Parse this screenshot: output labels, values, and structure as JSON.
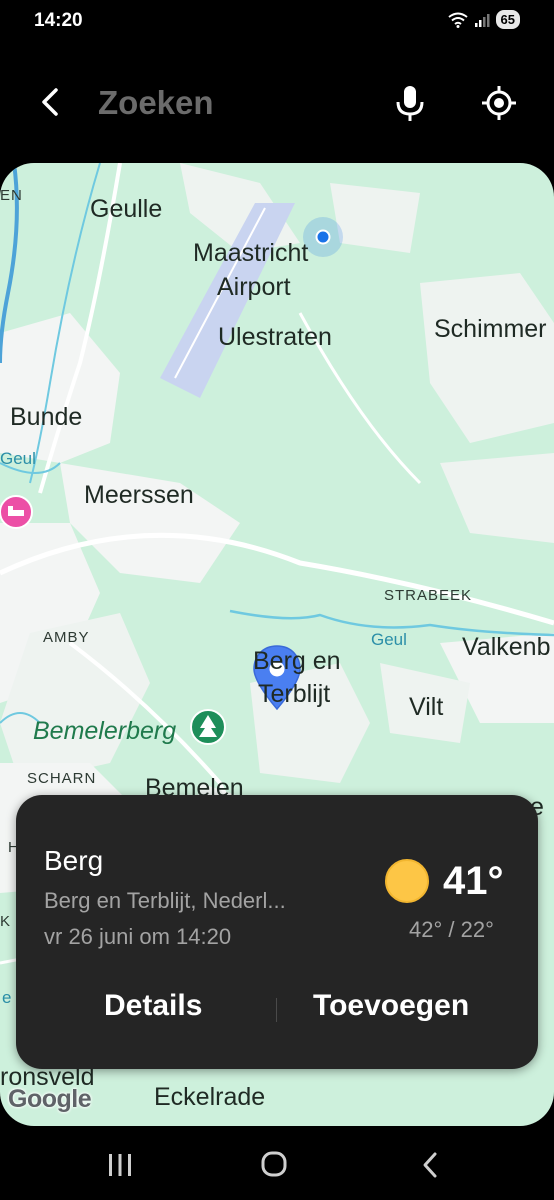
{
  "status_bar": {
    "time": "14:20",
    "battery": "65",
    "icons": [
      "wifi-icon",
      "signal-icon",
      "battery-icon"
    ]
  },
  "search": {
    "placeholder": "Zoeken",
    "value": "",
    "icons": [
      "back-arrow-icon",
      "mic-icon",
      "my-location-icon"
    ]
  },
  "map": {
    "labels": {
      "geulle": "Geulle",
      "en": "EN",
      "maastricht_airport_1": "Maastricht",
      "maastricht_airport_2": "Airport",
      "ulestraten": "Ulestraten",
      "schimmert": "Schimmer",
      "bunde": "Bunde",
      "geul_west": "Geul",
      "meerssen": "Meerssen",
      "strabeek": "STRABEEK",
      "amby": "AMBY",
      "geul_east": "Geul",
      "valkenburg": "Valkenb",
      "berg_1": "Berg en",
      "berg_2": "Terblijt",
      "vilt": "Vilt",
      "bemelerberg": "Bemelerberg",
      "scharn": "SCHARN",
      "bemelen": "Bemelen",
      "cadier_fragment": "e",
      "ronsveld": "ronsveld",
      "eckelrade": "Eckelrade",
      "left_edge_h": "H",
      "left_edge_k": "K",
      "left_edge_e": "e"
    },
    "attribution": "Google",
    "colors": {
      "land": "#cdf0dc",
      "urban": "#f3f5f4",
      "water": "#6fc9e0",
      "pin": "#4a7ff1",
      "location_dot": "#1a73e8",
      "hotel": "#ec4fa6",
      "park": "#1e8e5a"
    }
  },
  "card": {
    "title": "Berg",
    "subtitle": "Berg en Terblijt, Nederl...",
    "datetime": "vr 26 juni om 14:20",
    "temperature": "41°",
    "range": "42° / 22°",
    "weather_icon": "sun-icon",
    "details_label": "Details",
    "add_label": "Toevoegen"
  },
  "nav_bar": {
    "buttons": [
      "recents-icon",
      "home-icon",
      "back-icon"
    ]
  }
}
